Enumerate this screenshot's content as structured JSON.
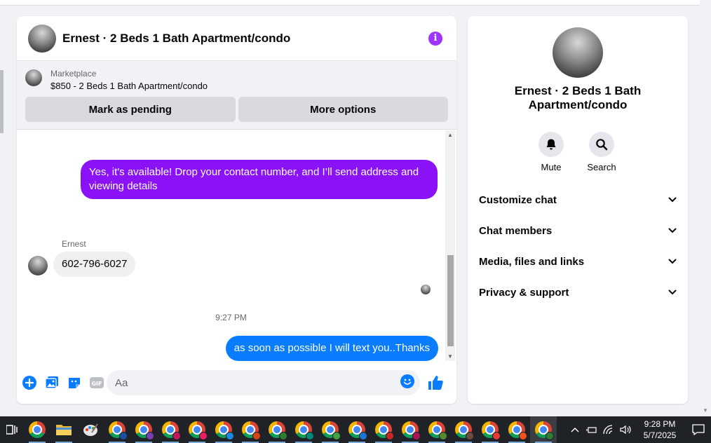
{
  "chat": {
    "title": "Ernest · 2 Beds 1 Bath Apartment/condo",
    "marketplace_label": "Marketplace",
    "listing": "$850 - 2 Beds 1 Bath Apartment/condo",
    "mark_pending_label": "Mark as pending",
    "more_options_label": "More options",
    "messages": [
      {
        "direction": "outgoing",
        "text": "Yes, it's available! Drop your contact number, and I’ll send address and viewing details"
      },
      {
        "direction": "incoming",
        "sender": "Ernest",
        "text": "602-796-6027"
      },
      {
        "direction": "outgoing",
        "text": "as soon as possible I will text you..Thanks"
      }
    ],
    "timestamp": "9:27 PM",
    "composer_placeholder": "Aa"
  },
  "info_panel": {
    "title": "Ernest · 2 Beds 1 Bath Apartment/condo",
    "actions": [
      {
        "label": "Mute",
        "icon": "bell-icon"
      },
      {
        "label": "Search",
        "icon": "search-icon"
      }
    ],
    "sections": [
      {
        "label": "Customize chat"
      },
      {
        "label": "Chat members"
      },
      {
        "label": "Media, files and links"
      },
      {
        "label": "Privacy & support"
      }
    ]
  },
  "taskbar": {
    "time": "9:28 PM",
    "date": "5/7/2025"
  },
  "colors": {
    "purple_bubble": "#8b11f6",
    "blue_bubble": "#0a7cff",
    "messenger_blue": "#0a7cff",
    "info_icon": "#a033ff"
  }
}
